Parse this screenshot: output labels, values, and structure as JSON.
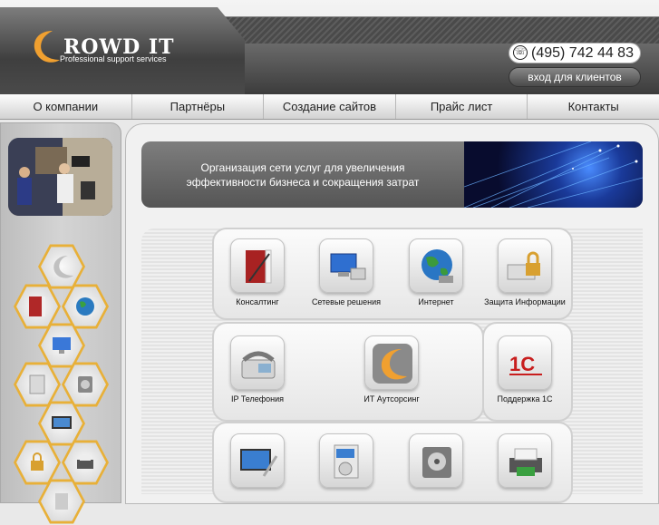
{
  "header": {
    "logo_text": "ROWD IT",
    "logo_subtitle": "Professional support services",
    "phone": "(495) 742 44 83",
    "client_login_label": "вход для клиентов"
  },
  "nav": {
    "items": [
      {
        "label": "О компании"
      },
      {
        "label": "Партнёры"
      },
      {
        "label": "Создание сайтов"
      },
      {
        "label": "Прайс лист"
      },
      {
        "label": "Контакты"
      }
    ]
  },
  "banner": {
    "line1": "Организация сети услуг для увеличения",
    "line2": "эффективности бизнеса и сокращения затрат"
  },
  "services": [
    {
      "label": "Консалтинг",
      "icon": "book-icon"
    },
    {
      "label": "Сетевые решения",
      "icon": "network-icon"
    },
    {
      "label": "Интернет",
      "icon": "globe-icon"
    },
    {
      "label": "Защита Информации",
      "icon": "lock-icon"
    },
    {
      "label": "IP Телефония",
      "icon": "phone-icon"
    },
    {
      "label": "ИТ Аутсорсинг",
      "icon": "crowd-logo-icon"
    },
    {
      "label": "Поддержка 1С",
      "icon": "1c-icon"
    },
    {
      "label": "",
      "icon": "monitor-tools-icon"
    },
    {
      "label": "",
      "icon": "software-box-icon"
    },
    {
      "label": "",
      "icon": "hard-drive-icon"
    },
    {
      "label": "",
      "icon": "printer-icon"
    }
  ],
  "colors": {
    "accent_orange": "#e8b038",
    "header_dark": "#4a4a4a",
    "nav_text": "#222222"
  }
}
